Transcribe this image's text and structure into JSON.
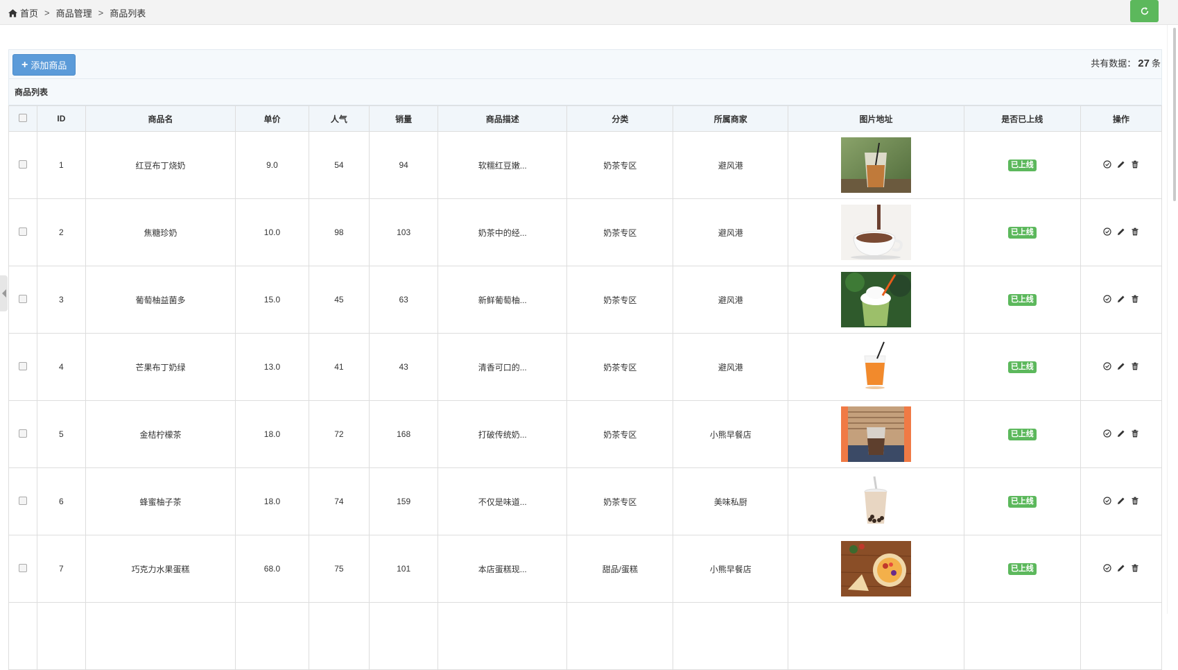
{
  "breadcrumb": {
    "home": "首页",
    "sep": ">",
    "level1": "商品管理",
    "level2": "商品列表"
  },
  "toolbar": {
    "add_label": "添加商品",
    "total_prefix": "共有数据：",
    "total_count": "27",
    "total_suffix": "条"
  },
  "section_title": "商品列表",
  "columns": [
    "ID",
    "商品名",
    "单价",
    "人气",
    "销量",
    "商品描述",
    "分类",
    "所属商家",
    "图片地址",
    "是否已上线",
    "操作"
  ],
  "rows": [
    {
      "id": "1",
      "name": "红豆布丁烧奶",
      "price": "9.0",
      "popularity": "54",
      "sales": "94",
      "desc": "软糯红豆嫩...",
      "category": "奶茶专区",
      "merchant": "避风港",
      "image": "iced-milk-tea",
      "status": "已上线"
    },
    {
      "id": "2",
      "name": "焦糖珍奶",
      "price": "10.0",
      "popularity": "98",
      "sales": "103",
      "desc": "奶茶中的经...",
      "category": "奶茶专区",
      "merchant": "避风港",
      "image": "hot-chocolate-cup",
      "status": "已上线"
    },
    {
      "id": "3",
      "name": "葡萄柚益菌多",
      "price": "15.0",
      "popularity": "45",
      "sales": "63",
      "desc": "新鲜葡萄柚...",
      "category": "奶茶专区",
      "merchant": "避风港",
      "image": "matcha-frappe",
      "status": "已上线"
    },
    {
      "id": "4",
      "name": "芒果布丁奶绿",
      "price": "13.0",
      "popularity": "41",
      "sales": "43",
      "desc": "清香可口的...",
      "category": "奶茶专区",
      "merchant": "避风港",
      "image": "orange-juice-cup",
      "status": "已上线"
    },
    {
      "id": "5",
      "name": "金桔柠檬茶",
      "price": "18.0",
      "popularity": "72",
      "sales": "168",
      "desc": "打破传统奶...",
      "category": "奶茶专区",
      "merchant": "小熊早餐店",
      "image": "iced-coffee-window",
      "status": "已上线"
    },
    {
      "id": "6",
      "name": "蜂蜜柚子茶",
      "price": "18.0",
      "popularity": "74",
      "sales": "159",
      "desc": "不仅是味道...",
      "category": "奶茶专区",
      "merchant": "美味私厨",
      "image": "bubble-tea-cup",
      "status": "已上线"
    },
    {
      "id": "7",
      "name": "巧克力水果蛋糕",
      "price": "68.0",
      "popularity": "75",
      "sales": "101",
      "desc": "本店蛋糕现...",
      "category": "甜品/蛋糕",
      "merchant": "小熊早餐店",
      "image": "fruit-cake-table",
      "status": "已上线"
    }
  ],
  "colors": {
    "accent_blue": "#5b9bd9",
    "success_green": "#5cb85c"
  }
}
